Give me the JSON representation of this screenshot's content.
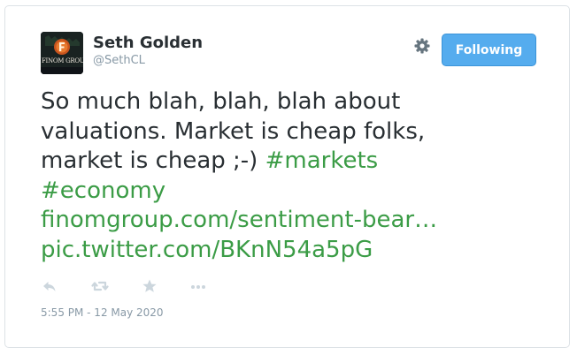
{
  "user": {
    "display_name": "Seth Golden",
    "handle": "@SethCL",
    "avatar_text": "FINOM GROUP"
  },
  "follow_button": {
    "label": "Following"
  },
  "tweet": {
    "text_lines": [
      "So much blah, blah, blah about",
      "valuations. Market is cheap folks,",
      "market is cheap ;-) "
    ],
    "hashtags": [
      "#markets",
      "#economy"
    ],
    "link": "finomgroup.com/sentiment-bear…",
    "pic_link": "pic.twitter.com/BKnN54a5pG"
  },
  "timestamp": "5:55 PM - 12 May 2020",
  "icons": {
    "settings": "gear-icon",
    "reply": "reply-icon",
    "retweet": "retweet-icon",
    "favorite": "star-icon",
    "more": "more-icon"
  },
  "colors": {
    "follow_button": "#55acee",
    "hashtag_link": "#3b9c46",
    "text": "#292f33",
    "muted": "#8899a6"
  }
}
